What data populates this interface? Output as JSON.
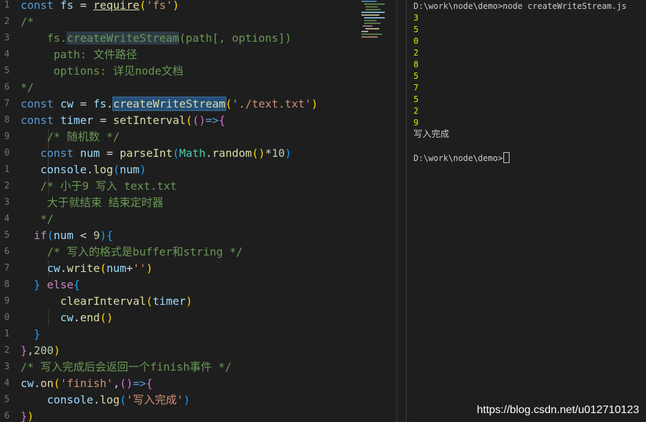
{
  "editor": {
    "line_numbers": [
      "1",
      "2",
      "3",
      "4",
      "5",
      "6",
      "7",
      "8",
      "9",
      "0",
      "1",
      "2",
      "3",
      "4",
      "5",
      "6",
      "7",
      "8",
      "9",
      "0",
      "1",
      "2",
      "3",
      "4",
      "5",
      "6"
    ],
    "tokens": {
      "const": "const",
      "fs": "fs",
      "require": "require",
      "fs_str": "'fs'",
      "comment_open": "/*",
      "comment_fs": "fs.",
      "comment_cws": "createWriteStream",
      "comment_args": "(path[, options])",
      "comment_path": "path: 文件路径",
      "comment_options": "options: 详见node文档",
      "comment_close": "*/",
      "cw": "cw",
      "createWriteStream": "createWriteStream",
      "path_str": "'./text.txt'",
      "timer": "timer",
      "setInterval": "setInterval",
      "comment_random": "/* 随机数 */",
      "num": "num",
      "parseInt": "parseInt",
      "Math": "Math",
      "random": "random",
      "ten": "10",
      "console": "console",
      "log": "log",
      "comment_lt9_a": "/* 小于9 写入 text.txt",
      "comment_lt9_b": "大于就结束 结束定时器",
      "comment_lt9_c": "*/",
      "if": "if",
      "nine": "9",
      "comment_buffer": "/* 写入的格式是buffer和string */",
      "write": "write",
      "empty_str": "''",
      "else": "else",
      "clearInterval": "clearInterval",
      "end": "end",
      "two_hundred": "200",
      "comment_finish": "/* 写入完成后会返回一个finish事件 */",
      "on": "on",
      "finish_str": "'finish'",
      "done_str": "'写入完成'"
    }
  },
  "terminal": {
    "command_line": "D:\\work\\node\\demo>node createWriteStream.js",
    "outputs": [
      "3",
      "5",
      "0",
      "2",
      "8",
      "5",
      "7",
      "5",
      "2",
      "9"
    ],
    "finish_message": "写入完成",
    "prompt": "D:\\work\\node\\demo>"
  },
  "watermark": "https://blog.csdn.net/u012710123",
  "colors": {
    "background": "#1e1e1e",
    "keyword": "#569cd6",
    "variable": "#9cdcfe",
    "function": "#dcdcaa",
    "string": "#ce9178",
    "comment": "#6a9955",
    "number": "#b5cea8",
    "terminal_output": "#e5e510"
  }
}
